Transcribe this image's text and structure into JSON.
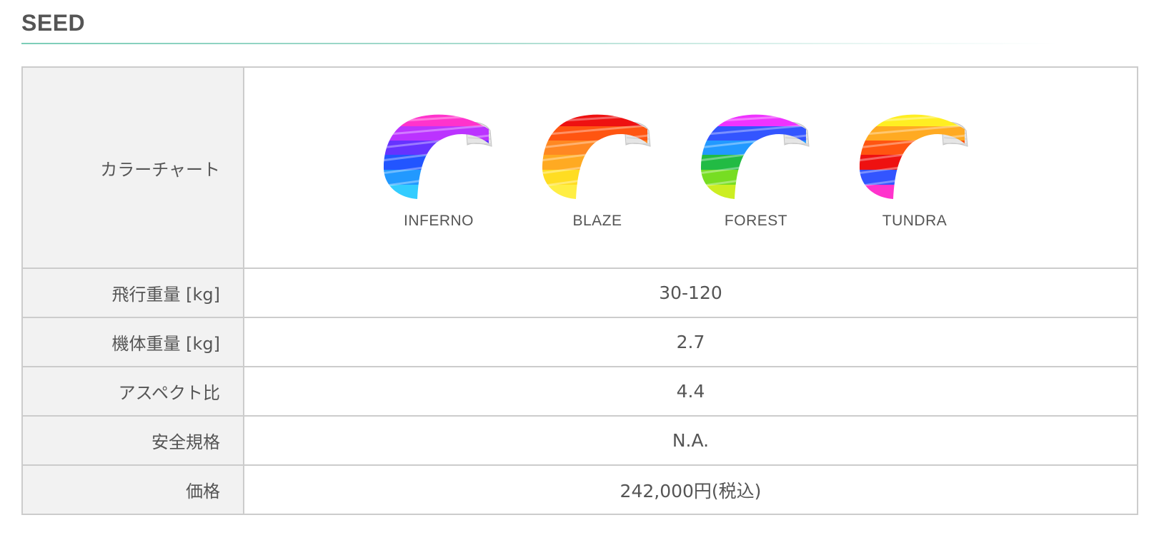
{
  "title": "SEED",
  "colors": {
    "title_rule": "#7ccdb8",
    "border": "#cccccc",
    "label_bg": "#f2f2f2",
    "text": "#555555"
  },
  "color_chart": {
    "label": "カラーチャート",
    "kites": [
      {
        "name": "INFERNO",
        "stripes": [
          "#ff33cc",
          "#bb33ff",
          "#6633ff",
          "#2255ff",
          "#2299ff",
          "#33ccff"
        ]
      },
      {
        "name": "BLAZE",
        "stripes": [
          "#ee1111",
          "#ff5511",
          "#ff8822",
          "#ffaa22",
          "#ffdd22",
          "#ffee44"
        ]
      },
      {
        "name": "FOREST",
        "stripes": [
          "#ee33ff",
          "#3355ff",
          "#2299ff",
          "#22bb44",
          "#77dd22",
          "#ccee22"
        ]
      },
      {
        "name": "TUNDRA",
        "stripes": [
          "#ffee22",
          "#ffaa22",
          "#ff5511",
          "#ee1111",
          "#3355ff",
          "#ff33cc"
        ]
      }
    ]
  },
  "specs": [
    {
      "label": "飛行重量 [kg]",
      "value": "30-120"
    },
    {
      "label": "機体重量 [kg]",
      "value": "2.7"
    },
    {
      "label": "アスペクト比",
      "value": "4.4"
    },
    {
      "label": "安全規格",
      "value": "N.A."
    },
    {
      "label": "価格",
      "value": "242,000円(税込)"
    }
  ]
}
